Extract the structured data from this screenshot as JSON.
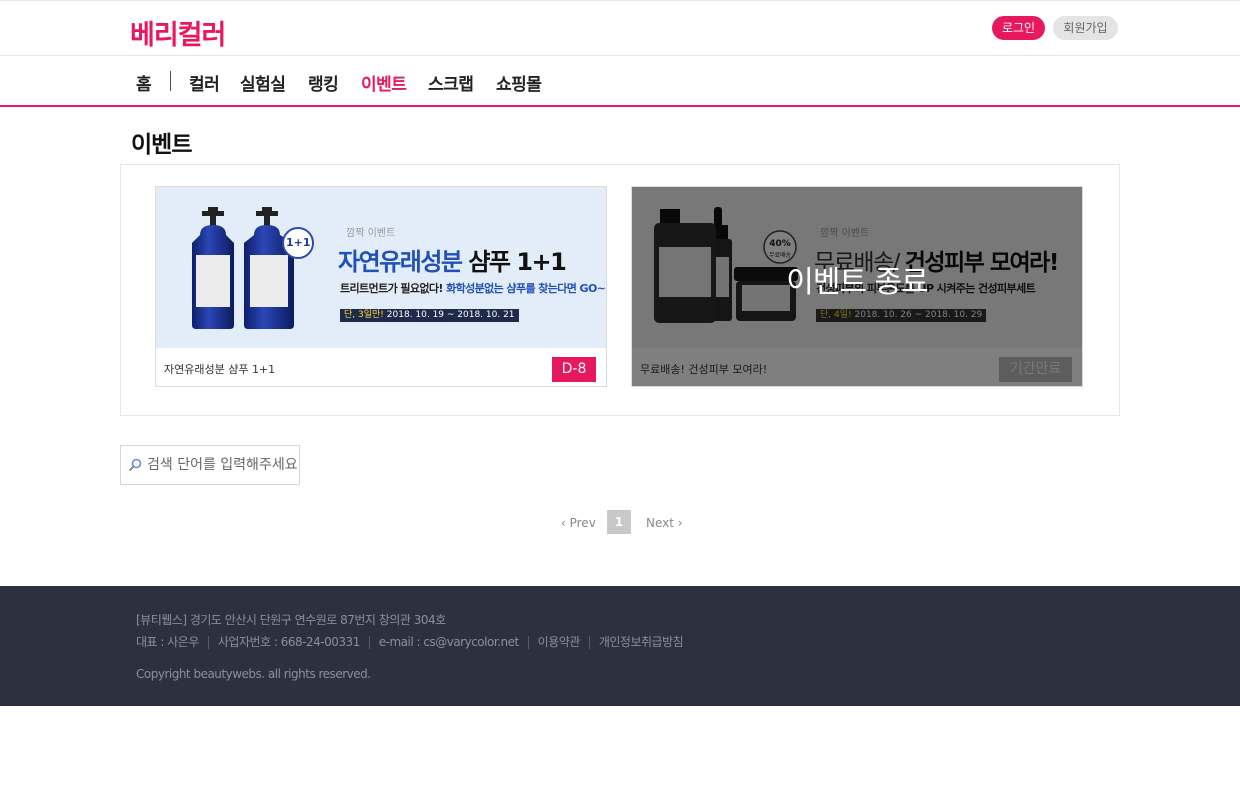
{
  "header": {
    "logo": "베리컬러",
    "login_label": "로그인",
    "join_label": "회원가입"
  },
  "nav": {
    "items": [
      {
        "label": "홈"
      },
      {
        "label": "컬러"
      },
      {
        "label": "실험실"
      },
      {
        "label": "랭킹"
      },
      {
        "label": "이벤트",
        "active": true
      },
      {
        "label": "스크랩"
      },
      {
        "label": "쇼핑몰"
      }
    ]
  },
  "page": {
    "title": "이벤트"
  },
  "events": [
    {
      "banner_tag": "깜짝 이벤트",
      "banner_headline_a": "자연유래성분",
      "banner_headline_b": " 샴푸 1+1",
      "banner_sub_a": "트리트먼트가 필요없다! ",
      "banner_sub_b": "화학성분없는 샴푸를 찾는다면 GO~",
      "banner_badge": "1+1",
      "banner_date_lead": "단, 3일만!",
      "banner_date": " 2018. 10. 19 ~ 2018. 10. 21",
      "name": "자연유래성분 샴푸 1+1",
      "status": "D-8"
    },
    {
      "banner_tag": "깜짝 이벤트",
      "banner_headline_a": "무료배송/ ",
      "banner_headline_b": "건성피부 모여라!",
      "banner_sub": "건성피부의 피부온도를 UP 시켜주는 건성피부세트",
      "banner_badge_a": "40%",
      "banner_badge_b": "무료배송",
      "banner_date_lead": "단, 4일!",
      "banner_date": " 2018. 10. 26 ~ 2018. 10. 29",
      "overlay": "이벤트 종료",
      "name": "무료배송! 건성피부 모여라!",
      "status": "기간만료"
    }
  ],
  "search": {
    "placeholder": "검색 단어를 입력해주세요"
  },
  "pagination": {
    "prev": "‹ Prev",
    "current": "1",
    "next": "Next ›"
  },
  "footer": {
    "address": "[뷰티웹스] 경기도 안산시 단원구 연수원로 87번지 창의관 304호",
    "ceo": "대표 : 사은우",
    "biz_no": "사업자번호 : 668-24-00331",
    "email": "e-mail : cs@varycolor.net",
    "terms": "이용약관",
    "privacy": "개인정보취급방침",
    "copyright": "Copyright beautywebs. all rights reserved."
  },
  "colors": {
    "accent": "#e8185f",
    "footer_bg": "#2b313f"
  },
  "icons": {
    "search": "search-icon"
  }
}
